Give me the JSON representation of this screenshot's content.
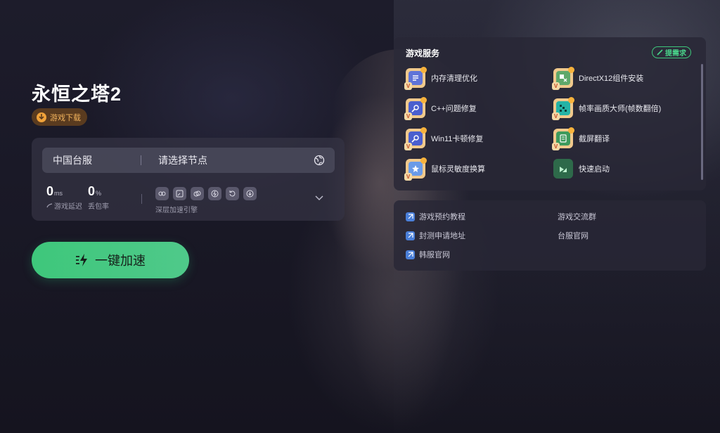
{
  "game": {
    "title": "永恒之塔2",
    "download_label": "游戏下载"
  },
  "accelerator": {
    "region": "中国台服",
    "node_placeholder": "请选择节点",
    "latency": {
      "value": "0",
      "unit": "ms",
      "caption": "游戏延迟"
    },
    "packet_loss": {
      "value": "0",
      "unit": "%",
      "caption": "丢包率"
    },
    "engine_caption": "深层加速引擎",
    "engine_icons": [
      "link-icon",
      "window-icon",
      "rings-icon",
      "bolt-icon",
      "refresh-icon",
      "download-icon"
    ],
    "boost_label": "一键加速"
  },
  "services": {
    "title": "游戏服务",
    "request_label": "提需求",
    "items": [
      {
        "label": "内存清理优化",
        "icon": "memory-icon"
      },
      {
        "label": "DirectX12组件安装",
        "icon": "directx-icon"
      },
      {
        "label": "C++问题修复",
        "icon": "wrench-icon"
      },
      {
        "label": "帧率画质大师(帧数翻倍)",
        "icon": "framerate-icon"
      },
      {
        "label": "Win11卡顿修复",
        "icon": "wrench-icon"
      },
      {
        "label": "截屏翻译",
        "icon": "translate-icon"
      },
      {
        "label": "鼠标灵敏度换算",
        "icon": "mouse-icon"
      },
      {
        "label": "快速启动",
        "icon": "launch-icon"
      }
    ]
  },
  "links": [
    {
      "label": "游戏预约教程",
      "has_icon": true
    },
    {
      "label": "游戏交流群",
      "has_icon": false
    },
    {
      "label": "封测申请地址",
      "has_icon": true
    },
    {
      "label": "台服官网",
      "has_icon": false
    },
    {
      "label": "韩服官网",
      "has_icon": true
    }
  ],
  "colors": {
    "accent_green": "#3ec77b",
    "download_orange": "#f0a23a",
    "vip_badge": "#f3d9a6"
  }
}
